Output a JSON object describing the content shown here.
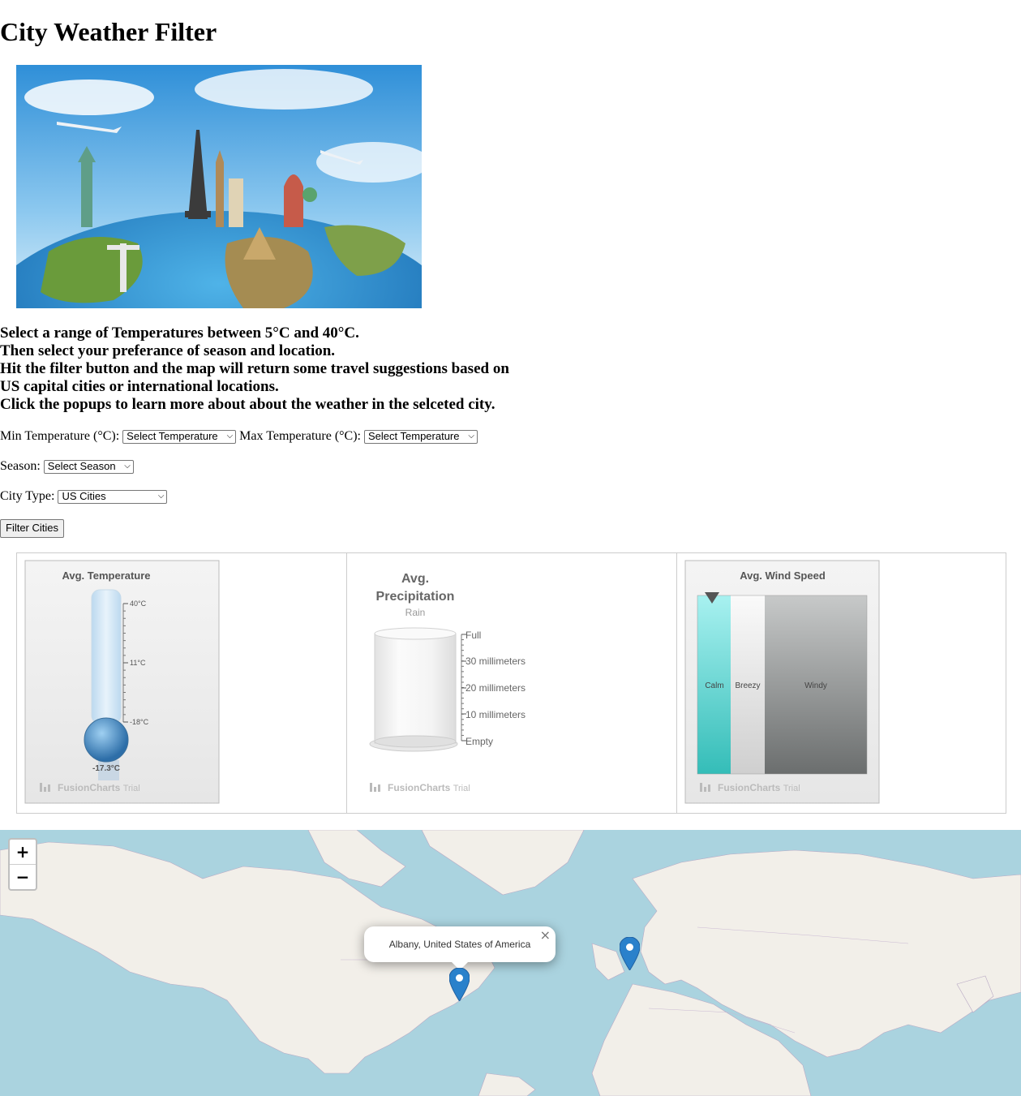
{
  "page": {
    "title": "City Weather Filter",
    "instructions": [
      "Select a range of Temperatures between 5°C and 40°C.",
      "Then select your preferance of season and location.",
      "Hit the filter button and the map will return some travel suggestions based on",
      "US capital cities or international locations.",
      "Click the popups to learn more about about the weather in the selceted city."
    ]
  },
  "filters": {
    "min_temp_label": "Min Temperature (°C):",
    "min_temp_value": "Select Temperature",
    "max_temp_label": "Max Temperature (°C):",
    "max_temp_value": "Select Temperature",
    "season_label": "Season:",
    "season_value": "Select Season",
    "city_type_label": "City Type:",
    "city_type_value": "US Cities",
    "filter_button": "Filter Cities"
  },
  "gauges": {
    "temperature": {
      "caption": "Avg. Temperature",
      "ticks": [
        "40°C",
        "11°C",
        "-18°C"
      ],
      "value_label": "-17.3°C",
      "value": -17.3,
      "trial": "FusionCharts",
      "trial_suffix": "Trial"
    },
    "precipitation": {
      "caption_line1": "Avg.",
      "caption_line2": "Precipitation",
      "subcaption": "Rain",
      "ticks": [
        "Full",
        "30 millimeters",
        "20 millimeters",
        "10 millimeters",
        "Empty"
      ],
      "trial": "FusionCharts",
      "trial_suffix": "Trial"
    },
    "wind": {
      "caption": "Avg. Wind Speed",
      "bands": [
        "Calm",
        "Breezy",
        "Windy"
      ],
      "band_colors": [
        "#3cc6c4",
        "#e6e6e6",
        "#7a7c7c"
      ],
      "trial": "FusionCharts",
      "trial_suffix": "Trial"
    }
  },
  "map": {
    "zoom_in": "+",
    "zoom_out": "−",
    "popup_text": "Albany, United States of America",
    "popup_close": "×",
    "marker_color": "#2a81cb"
  }
}
